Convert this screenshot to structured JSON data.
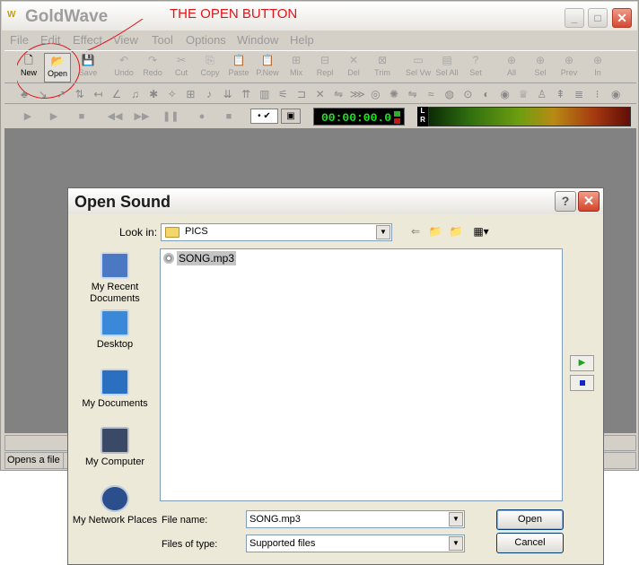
{
  "app": {
    "title": "GoldWave",
    "logo_text": "W",
    "window_buttons": {
      "minimize": "_",
      "maximize": "□",
      "close": "✕"
    }
  },
  "annotation": "THE OPEN BUTTON",
  "menu": [
    "File",
    "Edit",
    "Effect",
    "View",
    "Tool",
    "Options",
    "Window",
    "Help"
  ],
  "toolbar": [
    {
      "label": "New",
      "icon": "new-file-icon",
      "glyph": "🗋",
      "active": true
    },
    {
      "label": "Open",
      "icon": "open-folder-icon",
      "glyph": "📂",
      "active": true
    },
    {
      "label": "Save",
      "icon": "save-icon",
      "glyph": "💾",
      "active": false
    },
    {
      "label": "Undo",
      "icon": "undo-icon",
      "glyph": "↶",
      "active": false
    },
    {
      "label": "Redo",
      "icon": "redo-icon",
      "glyph": "↷",
      "active": false
    },
    {
      "label": "Cut",
      "icon": "scissors-icon",
      "glyph": "✂",
      "active": false
    },
    {
      "label": "Copy",
      "icon": "copy-icon",
      "glyph": "⎘",
      "active": false
    },
    {
      "label": "Paste",
      "icon": "paste-icon",
      "glyph": "📋",
      "active": false
    },
    {
      "label": "P.New",
      "icon": "paste-new-icon",
      "glyph": "📋",
      "active": false
    },
    {
      "label": "Mix",
      "icon": "mix-icon",
      "glyph": "⊞",
      "active": false
    },
    {
      "label": "Repl",
      "icon": "replace-icon",
      "glyph": "⊟",
      "active": false
    },
    {
      "label": "Del",
      "icon": "delete-icon",
      "glyph": "✕",
      "active": false
    },
    {
      "label": "Trim",
      "icon": "trim-icon",
      "glyph": "⊠",
      "active": false
    },
    {
      "label": "Sel Vw",
      "icon": "select-view-icon",
      "glyph": "▭",
      "active": false
    },
    {
      "label": "Sel All",
      "icon": "select-all-icon",
      "glyph": "▤",
      "active": false
    },
    {
      "label": "Set",
      "icon": "set-icon",
      "glyph": "?",
      "active": false
    },
    {
      "label": "All",
      "icon": "zoom-all-icon",
      "glyph": "⊕",
      "active": false
    },
    {
      "label": "Sel",
      "icon": "zoom-selection-icon",
      "glyph": "⊕",
      "active": false
    },
    {
      "label": "Prev",
      "icon": "zoom-previous-icon",
      "glyph": "⊕",
      "active": false
    },
    {
      "label": "In",
      "icon": "zoom-in-icon",
      "glyph": "⊕",
      "active": false
    }
  ],
  "effects_glyphs": [
    "♣",
    "↘",
    "↗",
    "⇅",
    "↤",
    "∠",
    "♫",
    "✱",
    "✧",
    "⊞",
    "♪",
    "⇊",
    "⇈",
    "▥",
    "⚟",
    "⊐",
    "✕",
    "⇋",
    "⋙",
    "◎",
    "✺",
    "⇋",
    "≈",
    "◍",
    "⊙",
    "◐",
    "◉",
    "♕",
    "♙",
    "⇞",
    "≣",
    "⁝",
    "◉"
  ],
  "transport": {
    "buttons": [
      "▶",
      "▶",
      "■",
      "◀◀",
      "▶▶",
      "❚❚",
      "●",
      "■"
    ],
    "loop_label": "• ✔",
    "stop_label": "▣",
    "time": "00:00:00.0",
    "lr_label": "L R"
  },
  "status": {
    "text": "Opens a file"
  },
  "dialog": {
    "title": "Open Sound",
    "help": "?",
    "close": "✕",
    "look_in_label": "Look in:",
    "look_in_value": "PICS",
    "nav": {
      "back": "⇐",
      "up_folder": "📁",
      "new_folder": "📁",
      "view_menu": "▦▾"
    },
    "places": [
      {
        "label": "My Recent Documents",
        "icon": "recent-documents-icon",
        "color": "#4a78c2"
      },
      {
        "label": "Desktop",
        "icon": "desktop-icon",
        "color": "#3a88d8"
      },
      {
        "label": "My Documents",
        "icon": "my-documents-icon",
        "color": "#2b6fc0"
      },
      {
        "label": "My Computer",
        "icon": "my-computer-icon",
        "color": "#3a4a66"
      },
      {
        "label": "My Network Places",
        "icon": "network-places-icon",
        "color": "#2a4f8c"
      }
    ],
    "files": [
      {
        "name": "SONG.mp3",
        "icon": "audio-file-icon"
      }
    ],
    "file_name_label": "File name:",
    "file_name_value": "SONG.mp3",
    "file_type_label": "Files of type:",
    "file_type_value": "Supported files",
    "open_label": "Open",
    "cancel_label": "Cancel",
    "preview_play": "▶",
    "accent_play": "#1ea51e",
    "accent_stop": "#1525c8"
  }
}
